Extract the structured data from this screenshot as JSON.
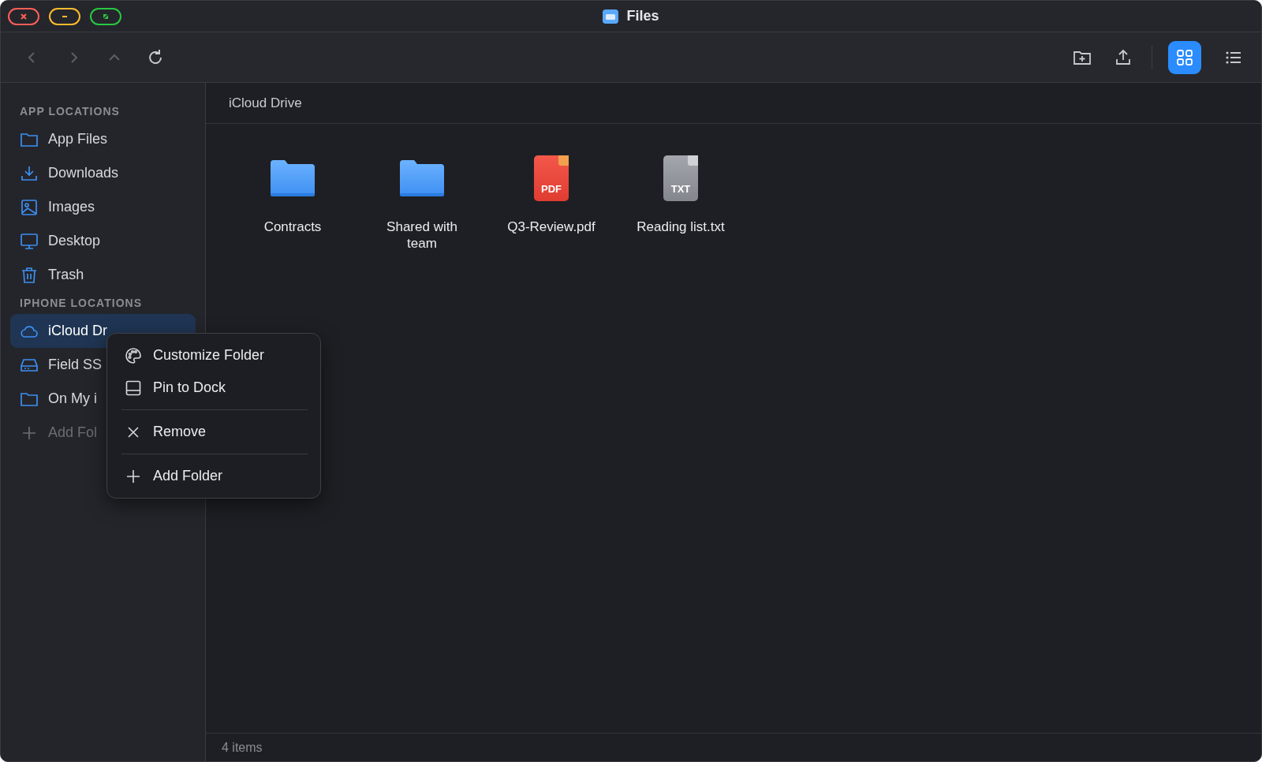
{
  "window": {
    "title": "Files"
  },
  "toolbar": {
    "back": {
      "disabled": true
    },
    "forward": {
      "disabled": true
    },
    "up": {
      "disabled": true
    },
    "views": [
      {
        "kind": "grid",
        "selected": true
      },
      {
        "kind": "list",
        "selected": false
      }
    ]
  },
  "sidebar": {
    "sections": [
      {
        "heading": "APP LOCATIONS",
        "items": [
          {
            "kind": "folder",
            "label": "App Files",
            "selected": false,
            "disabled": false
          },
          {
            "kind": "download",
            "label": "Downloads",
            "selected": false,
            "disabled": false
          },
          {
            "kind": "image",
            "label": "Images",
            "selected": false,
            "disabled": false
          },
          {
            "kind": "desktop",
            "label": "Desktop",
            "selected": false,
            "disabled": false
          },
          {
            "kind": "trash",
            "label": "Trash",
            "selected": false,
            "disabled": false
          }
        ]
      },
      {
        "heading": "IPHONE LOCATIONS",
        "items": [
          {
            "kind": "cloud",
            "label": "iCloud Dr",
            "selected": true,
            "disabled": false
          },
          {
            "kind": "drive",
            "label": "Field SS",
            "selected": false,
            "disabled": false
          },
          {
            "kind": "folder",
            "label": "On My i",
            "selected": false,
            "disabled": false
          },
          {
            "kind": "add",
            "label": "Add Fol",
            "selected": false,
            "disabled": true
          }
        ]
      }
    ]
  },
  "breadcrumb": "iCloud Drive",
  "files": [
    {
      "kind": "folder",
      "name": "Contracts"
    },
    {
      "kind": "folder",
      "name": "Shared with team"
    },
    {
      "kind": "pdf",
      "name": "Q3-Review.pdf",
      "badge": "PDF"
    },
    {
      "kind": "txt",
      "name": "Reading list.txt",
      "badge": "TXT"
    }
  ],
  "status_bar": "4 items",
  "context_menu": {
    "groups": [
      [
        {
          "kind": "palette",
          "label": "Customize Folder"
        },
        {
          "kind": "dock",
          "label": "Pin to Dock"
        }
      ],
      [
        {
          "kind": "remove",
          "label": "Remove"
        }
      ],
      [
        {
          "kind": "add",
          "label": "Add Folder"
        }
      ]
    ]
  }
}
